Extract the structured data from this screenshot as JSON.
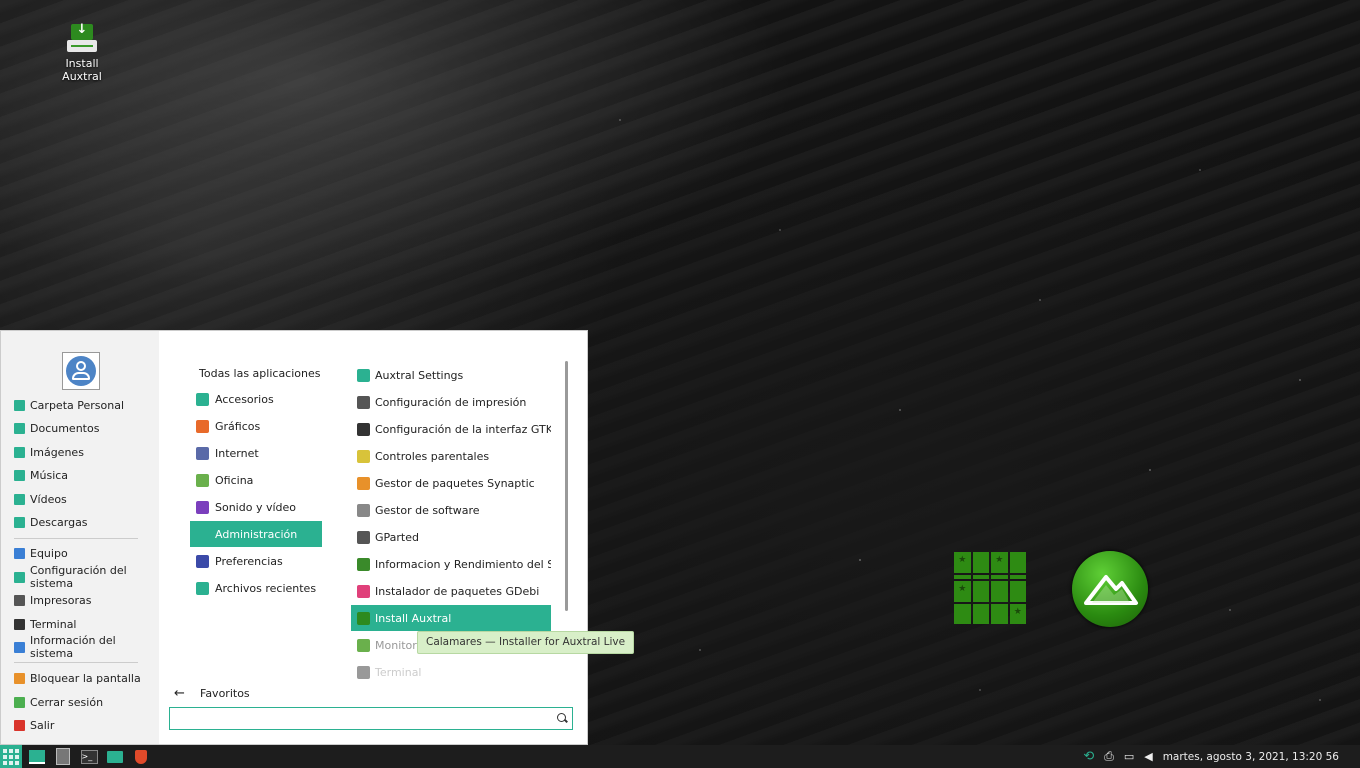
{
  "desktop": {
    "icon_label": "Install Auxtral"
  },
  "menu": {
    "places": [
      {
        "label": "Carpeta Personal",
        "color": "#2bb191"
      },
      {
        "label": "Documentos",
        "color": "#2bb191"
      },
      {
        "label": "Imágenes",
        "color": "#2bb191"
      },
      {
        "label": "Música",
        "color": "#2bb191"
      },
      {
        "label": "Vídeos",
        "color": "#2bb191"
      },
      {
        "label": "Descargas",
        "color": "#2bb191"
      }
    ],
    "system": [
      {
        "label": "Equipo",
        "color": "#3a7fd5"
      },
      {
        "label": "Configuración del sistema",
        "color": "#2bb191"
      },
      {
        "label": "Impresoras",
        "color": "#555555"
      },
      {
        "label": "Terminal",
        "color": "#333333"
      },
      {
        "label": "Información del sistema",
        "color": "#3a7fd5"
      }
    ],
    "session": [
      {
        "label": "Bloquear la pantalla",
        "color": "#e8912a"
      },
      {
        "label": "Cerrar sesión",
        "color": "#4caf50"
      },
      {
        "label": "Salir",
        "color": "#d9342b"
      }
    ],
    "all_apps_label": "Todas las aplicaciones",
    "categories": [
      {
        "label": "Accesorios",
        "color": "#2bb191"
      },
      {
        "label": "Gráficos",
        "color": "#e86a2a"
      },
      {
        "label": "Internet",
        "color": "#5a6aa8"
      },
      {
        "label": "Oficina",
        "color": "#6ab04c"
      },
      {
        "label": "Sonido y vídeo",
        "color": "#7b3fbd"
      },
      {
        "label": "Administración",
        "color": "#2bb191"
      },
      {
        "label": "Preferencias",
        "color": "#3b4aa8"
      },
      {
        "label": "Archivos recientes",
        "color": "#2bb191"
      }
    ],
    "active_category": "Administración",
    "apps": [
      {
        "label": "Auxtral Settings",
        "color": "#2bb191"
      },
      {
        "label": "Configuración de impresión",
        "color": "#555555"
      },
      {
        "label": "Configuración de la interfaz GTK+ ...",
        "color": "#333333"
      },
      {
        "label": "Controles parentales",
        "color": "#d8c33a"
      },
      {
        "label": "Gestor de paquetes Synaptic",
        "color": "#e8912a"
      },
      {
        "label": "Gestor de software",
        "color": "#888888"
      },
      {
        "label": "GParted",
        "color": "#555555"
      },
      {
        "label": "Informacion y Rendimiento del Sis...",
        "color": "#3a8a2a"
      },
      {
        "label": "Instalador de paquetes GDebi",
        "color": "#e0407a"
      },
      {
        "label": "Install Auxtral",
        "color": "#2d8a1f"
      },
      {
        "label": "Monitor c",
        "color": "#6ab04c"
      },
      {
        "label": "Terminal",
        "color": "#999999"
      }
    ],
    "active_app": "Install Auxtral",
    "tooltip": "Calamares — Installer for Auxtral Live",
    "favorites_label": "Favoritos",
    "search": {
      "value": "",
      "placeholder": ""
    }
  },
  "taskbar": {
    "clock": "martes, agosto  3, 2021, 13:20 56",
    "accent": "#2bb191"
  }
}
